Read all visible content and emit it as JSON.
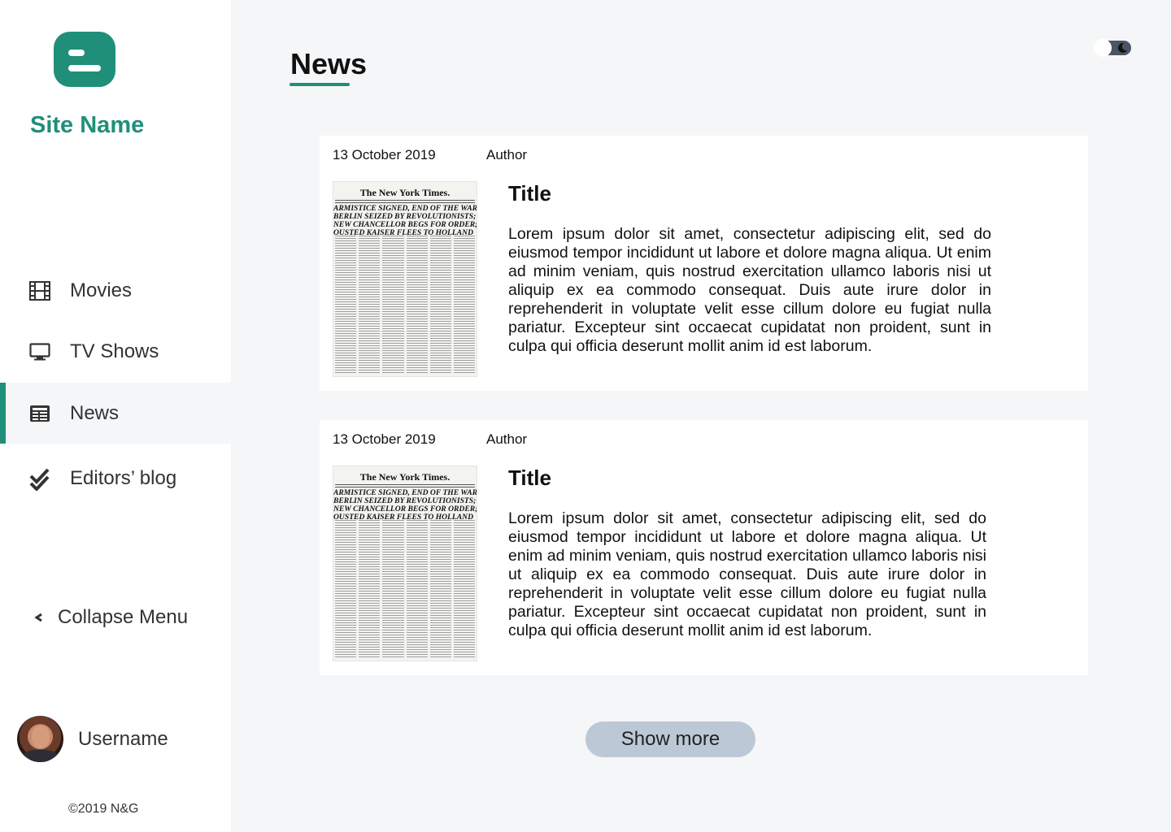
{
  "sidebar": {
    "site_name": "Site Name",
    "items": [
      {
        "label": "Movies",
        "icon": "film-icon"
      },
      {
        "label": "TV Shows",
        "icon": "monitor-icon"
      },
      {
        "label": "News",
        "icon": "newspaper-icon",
        "active": true
      },
      {
        "label": "Editors’ blog",
        "icon": "double-check-icon"
      }
    ],
    "collapse_label": "Collapse Menu",
    "username": "Username",
    "copyright": "©2019 N&G"
  },
  "main": {
    "title": "News",
    "articles": [
      {
        "date": "13 October 2019",
        "author": "Author",
        "title": "Title",
        "body": "Lorem ipsum dolor sit amet, consectetur adipiscing elit, sed do eiusmod tempor incididunt ut labore et dolore magna aliqua. Ut enim ad minim veniam, quis nostrud exercitation ullamco laboris nisi ut aliquip ex ea commodo consequat. Duis aute irure dolor in reprehenderit in voluptate velit esse cillum dolore eu fugiat nulla pariatur. Excepteur sint occaecat cupidatat non proident, sunt in culpa qui officia deserunt mollit anim id est laborum.",
        "image": {
          "masthead": "The New York Times.",
          "headlines": [
            "ARMISTICE SIGNED, END OF THE WAR!",
            "BERLIN SEIZED BY REVOLUTIONISTS;",
            "NEW CHANCELLOR BEGS FOR ORDER;",
            "OUSTED KAISER FLEES TO HOLLAND"
          ]
        }
      },
      {
        "date": "13 October 2019",
        "author": "Author",
        "title": "Title",
        "body": "Lorem ipsum dolor sit amet, consectetur adipiscing elit, sed do eiusmod tempor incididunt ut labore et dolore magna aliqua. Ut enim ad minim veniam, quis nostrud exercitation ullamco laboris nisi ut aliquip ex ea commodo consequat. Duis aute irure dolor in reprehenderit in voluptate velit esse cillum dolore eu fugiat nulla pariatur. Excepteur sint occaecat cupidatat non proident, sunt in culpa qui officia deserunt mollit anim id est laborum.",
        "image": {
          "masthead": "The New York Times.",
          "headlines": [
            "ARMISTICE SIGNED, END OF THE WAR!",
            "BERLIN SEIZED BY REVOLUTIONISTS;",
            "NEW CHANCELLOR BEGS FOR ORDER;",
            "OUSTED KAISER FLEES TO HOLLAND"
          ]
        }
      }
    ],
    "show_more_label": "Show more"
  },
  "theme_toggle": {
    "mode": "dark",
    "icon": "moon-icon"
  },
  "colors": {
    "accent": "#1f8f79",
    "button": "#bcc8d6",
    "background": "#f5f6f8",
    "toggle_track": "#4a5464"
  }
}
